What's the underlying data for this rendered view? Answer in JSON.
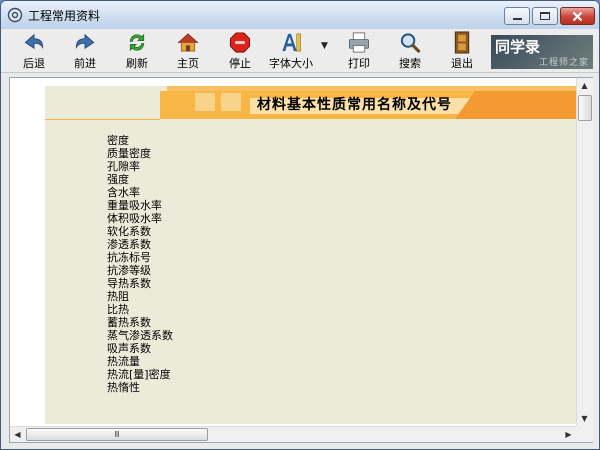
{
  "window": {
    "title": "工程常用资料",
    "minimize_label": "▁",
    "maximize_label": "□",
    "close_label": "✕"
  },
  "toolbar": {
    "items": [
      {
        "label": "后退",
        "icon": "back-arrow-icon"
      },
      {
        "label": "前进",
        "icon": "forward-arrow-icon"
      },
      {
        "label": "刷新",
        "icon": "refresh-icon"
      },
      {
        "label": "主页",
        "icon": "home-icon"
      },
      {
        "label": "停止",
        "icon": "stop-icon"
      },
      {
        "label": "字体大小",
        "icon": "font-size-icon"
      },
      {
        "label": "打印",
        "icon": "printer-icon"
      },
      {
        "label": "搜索",
        "icon": "magnifier-icon"
      },
      {
        "label": "退出",
        "icon": "exit-door-icon"
      }
    ],
    "dropdown_arrow": "▼",
    "brand_title": "同学录",
    "brand_subtitle": "工程师之家"
  },
  "page": {
    "title": "材料基本性质常用名称及代号",
    "terms": [
      "密度",
      "质量密度",
      "孔隙率",
      "强度",
      "含水率",
      "重量吸水率",
      "体积吸水率",
      "软化系数",
      "渗透系数",
      "抗冻标号",
      "抗渗等级",
      "导热系数",
      "热阻",
      "比热",
      "蓄热系数",
      "蒸气渗透系数",
      "吸声系数",
      "热流量",
      "热流[量]密度",
      "热惰性"
    ]
  },
  "scrollbars": {
    "h_thumb_grip": "Ⅲ",
    "up": "▲",
    "down": "▼",
    "left": "◀",
    "right": "▶"
  },
  "colors": {
    "content_bg": "#ecebd9",
    "accent_orange": "#f7b645",
    "close_red": "#c8453a"
  }
}
